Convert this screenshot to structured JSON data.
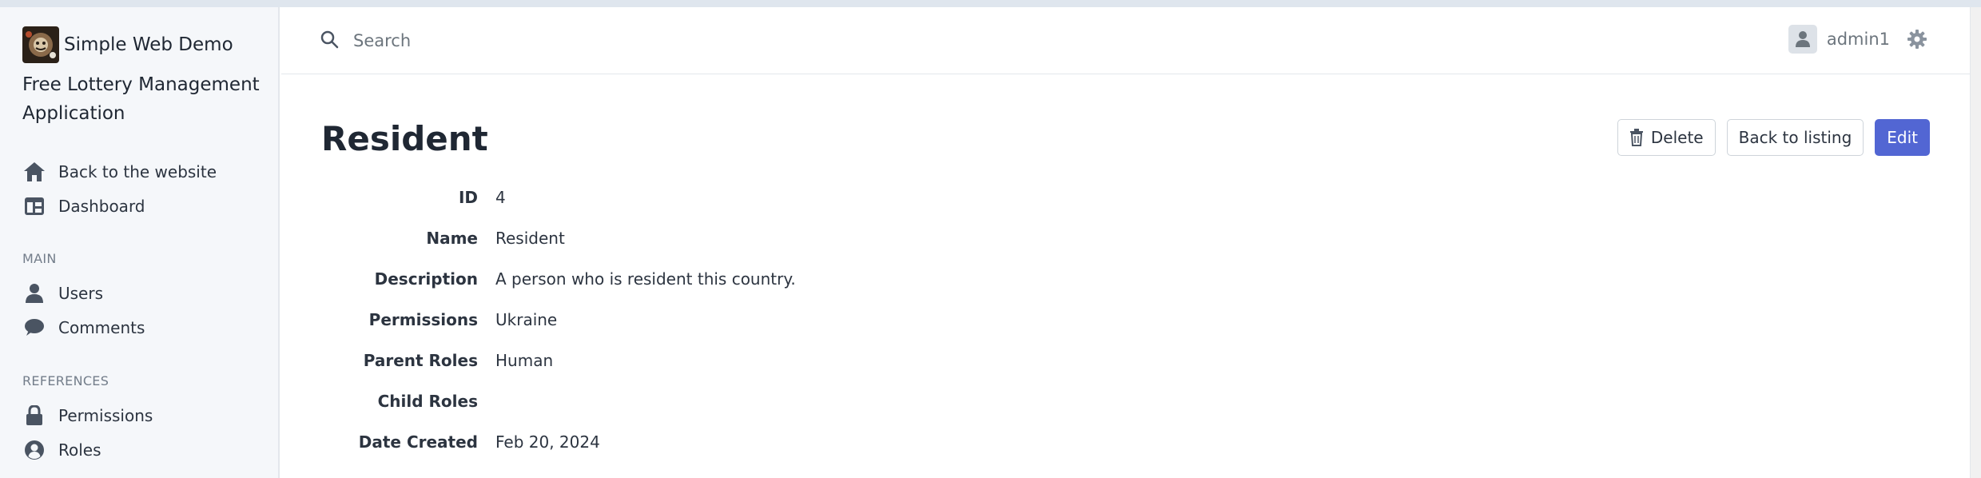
{
  "brand": {
    "title": "Simple Web Demo",
    "subtitle": "Free Lottery Management Application"
  },
  "sidebar": {
    "top_items": [
      {
        "label": "Back to the website",
        "icon": "home-icon"
      },
      {
        "label": "Dashboard",
        "icon": "dashboard-icon"
      }
    ],
    "sections": [
      {
        "title": "MAIN",
        "items": [
          {
            "label": "Users",
            "icon": "user-icon"
          },
          {
            "label": "Comments",
            "icon": "comment-icon"
          }
        ]
      },
      {
        "title": "REFERENCES",
        "items": [
          {
            "label": "Permissions",
            "icon": "lock-icon"
          },
          {
            "label": "Roles",
            "icon": "user-circle-icon"
          }
        ]
      }
    ]
  },
  "header": {
    "search_placeholder": "Search",
    "username": "admin1"
  },
  "page": {
    "title": "Resident",
    "actions": {
      "delete": "Delete",
      "back": "Back to listing",
      "edit": "Edit"
    },
    "fields": [
      {
        "label": "ID",
        "value": "4"
      },
      {
        "label": "Name",
        "value": "Resident"
      },
      {
        "label": "Description",
        "value": "A person who is resident this country."
      },
      {
        "label": "Permissions",
        "value": "Ukraine"
      },
      {
        "label": "Parent Roles",
        "value": "Human"
      },
      {
        "label": "Child Roles",
        "value": ""
      },
      {
        "label": "Date Created",
        "value": "Feb 20, 2024"
      }
    ]
  },
  "colors": {
    "primary": "#5266d3",
    "sidebar_bg": "#f5f7fa",
    "text": "#2c3440",
    "muted": "#6c757d"
  }
}
